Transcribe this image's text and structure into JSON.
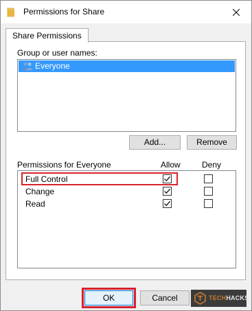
{
  "window": {
    "title": "Permissions for Share"
  },
  "tabs": [
    {
      "label": "Share Permissions"
    }
  ],
  "group_section": {
    "label": "Group or user names:",
    "users": [
      {
        "name": "Everyone",
        "selected": true
      }
    ]
  },
  "buttons": {
    "add": "Add...",
    "remove": "Remove",
    "ok": "OK",
    "cancel": "Cancel"
  },
  "permissions": {
    "label": "Permissions for Everyone",
    "allow_header": "Allow",
    "deny_header": "Deny",
    "rows": [
      {
        "name": "Full Control",
        "allow": true,
        "deny": false
      },
      {
        "name": "Change",
        "allow": true,
        "deny": false
      },
      {
        "name": "Read",
        "allow": true,
        "deny": false
      }
    ]
  },
  "watermark": {
    "part1": "TECH",
    "part2": "HACKS"
  },
  "colors": {
    "selection": "#3399ff",
    "highlight": "#d6212d",
    "ok_border": "#0078d7"
  }
}
